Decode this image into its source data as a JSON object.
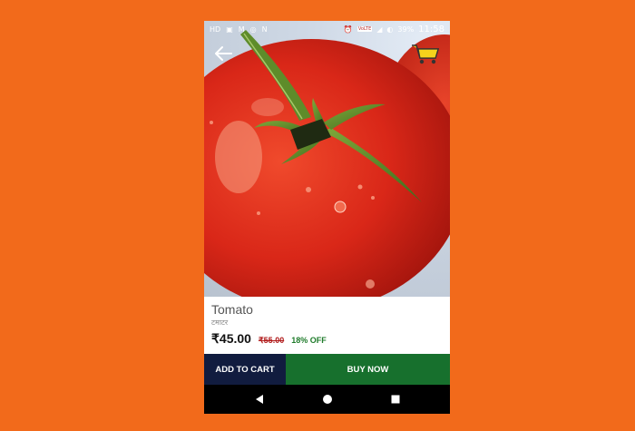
{
  "status_bar": {
    "left_labels": [
      "HD"
    ],
    "network_label": "VoLTE",
    "battery": "39%",
    "time": "11:58"
  },
  "product": {
    "name": "Tomato",
    "subname": "टमाटर",
    "price": "₹45.00",
    "old_price": "₹55.00",
    "discount": "18% OFF"
  },
  "buttons": {
    "add_to_cart": "ADD TO CART",
    "buy_now": "BUY NOW"
  },
  "colors": {
    "background": "#F26A1B",
    "add_to_cart_bg": "#111C3F",
    "buy_now_bg": "#17702D",
    "old_price": "#B21E1E",
    "discount": "#1E7B2A"
  },
  "icons": {
    "back": "arrow-left-icon",
    "cart": "shopping-cart-icon",
    "nav_back": "triangle-back-icon",
    "nav_home": "circle-home-icon",
    "nav_recent": "square-recent-icon"
  }
}
